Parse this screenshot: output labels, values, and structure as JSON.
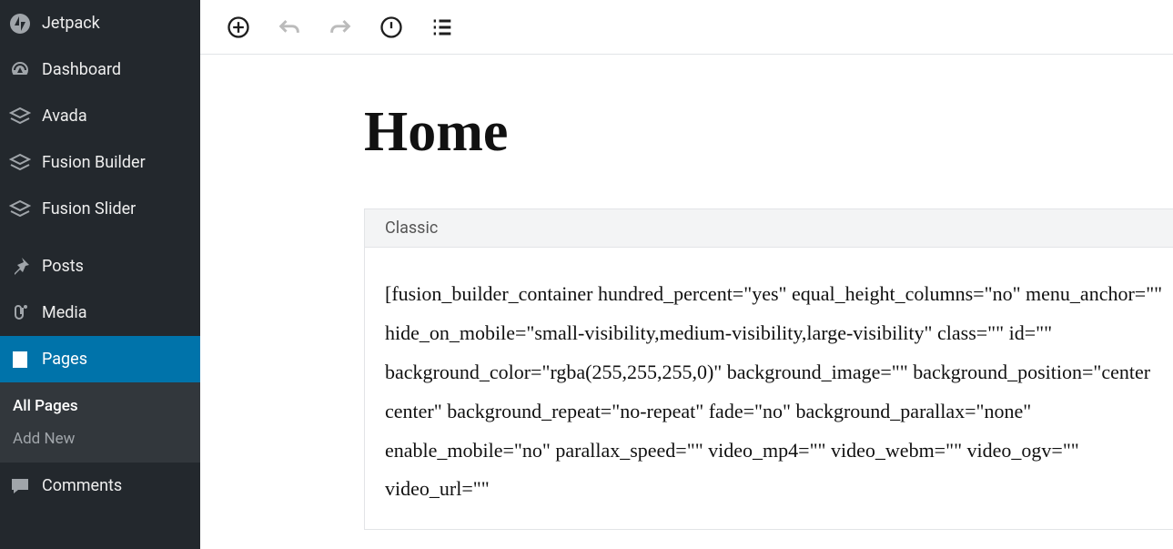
{
  "sidebar": {
    "items": [
      {
        "label": "Jetpack"
      },
      {
        "label": "Dashboard"
      },
      {
        "label": "Avada"
      },
      {
        "label": "Fusion Builder"
      },
      {
        "label": "Fusion Slider"
      },
      {
        "label": "Posts"
      },
      {
        "label": "Media"
      },
      {
        "label": "Pages"
      },
      {
        "label": "Comments"
      }
    ],
    "submenu": {
      "all_pages_label": "All Pages",
      "add_new_label": "Add New"
    }
  },
  "editor": {
    "page_title": "Home",
    "classic_label": "Classic",
    "content": "[fusion_builder_container hundred_percent=\"yes\" equal_height_columns=\"no\" menu_anchor=\"\" hide_on_mobile=\"small-visibility,medium-visibility,large-visibility\" class=\"\" id=\"\" background_color=\"rgba(255,255,255,0)\" background_image=\"\" background_position=\"center center\" background_repeat=\"no-repeat\" fade=\"no\" background_parallax=\"none\" enable_mobile=\"no\" parallax_speed=\"\" video_mp4=\"\" video_webm=\"\" video_ogv=\"\" video_url=\"\""
  }
}
